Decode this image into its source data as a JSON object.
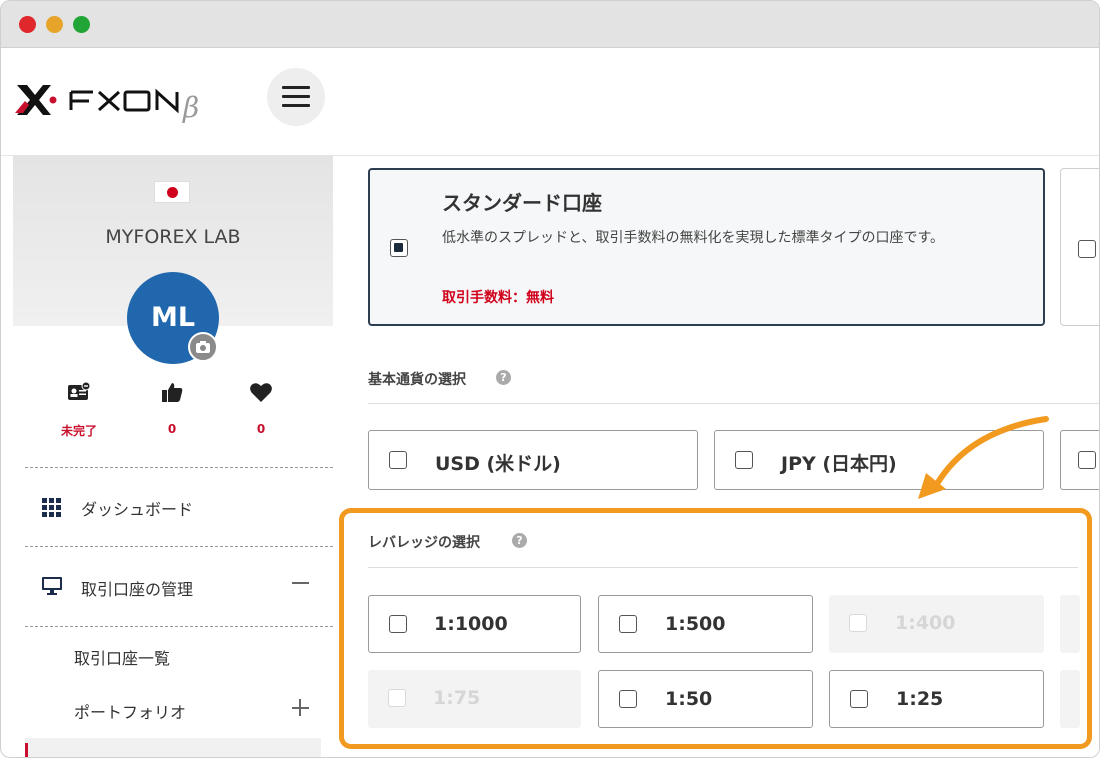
{
  "window": {
    "controls": [
      "close",
      "minimize",
      "maximize"
    ]
  },
  "header": {
    "logo_text": "FXON",
    "logo_suffix": "β",
    "brand_color": "#c8102e",
    "menu_icon": "hamburger-icon"
  },
  "sidebar": {
    "flag": "japan-flag",
    "profile_name": "MYFOREX LAB",
    "avatar_initials": "ML",
    "avatar_color": "#2067ad",
    "stats": [
      {
        "icon": "id-card-icon",
        "value": "未完了"
      },
      {
        "icon": "thumbs-up-icon",
        "value": "0"
      },
      {
        "icon": "heart-icon",
        "value": "0"
      }
    ],
    "menu": [
      {
        "icon": "grid-icon",
        "label": "ダッシュボード"
      },
      {
        "icon": "monitor-icon",
        "label": "取引口座の管理",
        "expanded": true
      }
    ],
    "submenu": [
      {
        "label": "取引口座一覧"
      },
      {
        "label": "ポートフォリオ"
      }
    ]
  },
  "main": {
    "account_type": {
      "title": "スタンダード口座",
      "description": "低水準のスプレッドと、取引手数料の無料化を実現した標準タイプの口座です。",
      "fee": "取引手数料：無料",
      "selected": true
    },
    "base_currency": {
      "label": "基本通貨の選択",
      "options": [
        {
          "label": "USD (米ドル)",
          "enabled": true
        },
        {
          "label": "JPY (日本円)",
          "enabled": true
        }
      ]
    },
    "leverage": {
      "label": "レバレッジの選択",
      "options": [
        {
          "label": "1:1000",
          "enabled": true
        },
        {
          "label": "1:500",
          "enabled": true
        },
        {
          "label": "1:400",
          "enabled": false
        },
        {
          "label": "1:75",
          "enabled": false
        },
        {
          "label": "1:50",
          "enabled": true
        },
        {
          "label": "1:25",
          "enabled": true
        }
      ]
    },
    "highlight_color": "#f29a1f"
  }
}
